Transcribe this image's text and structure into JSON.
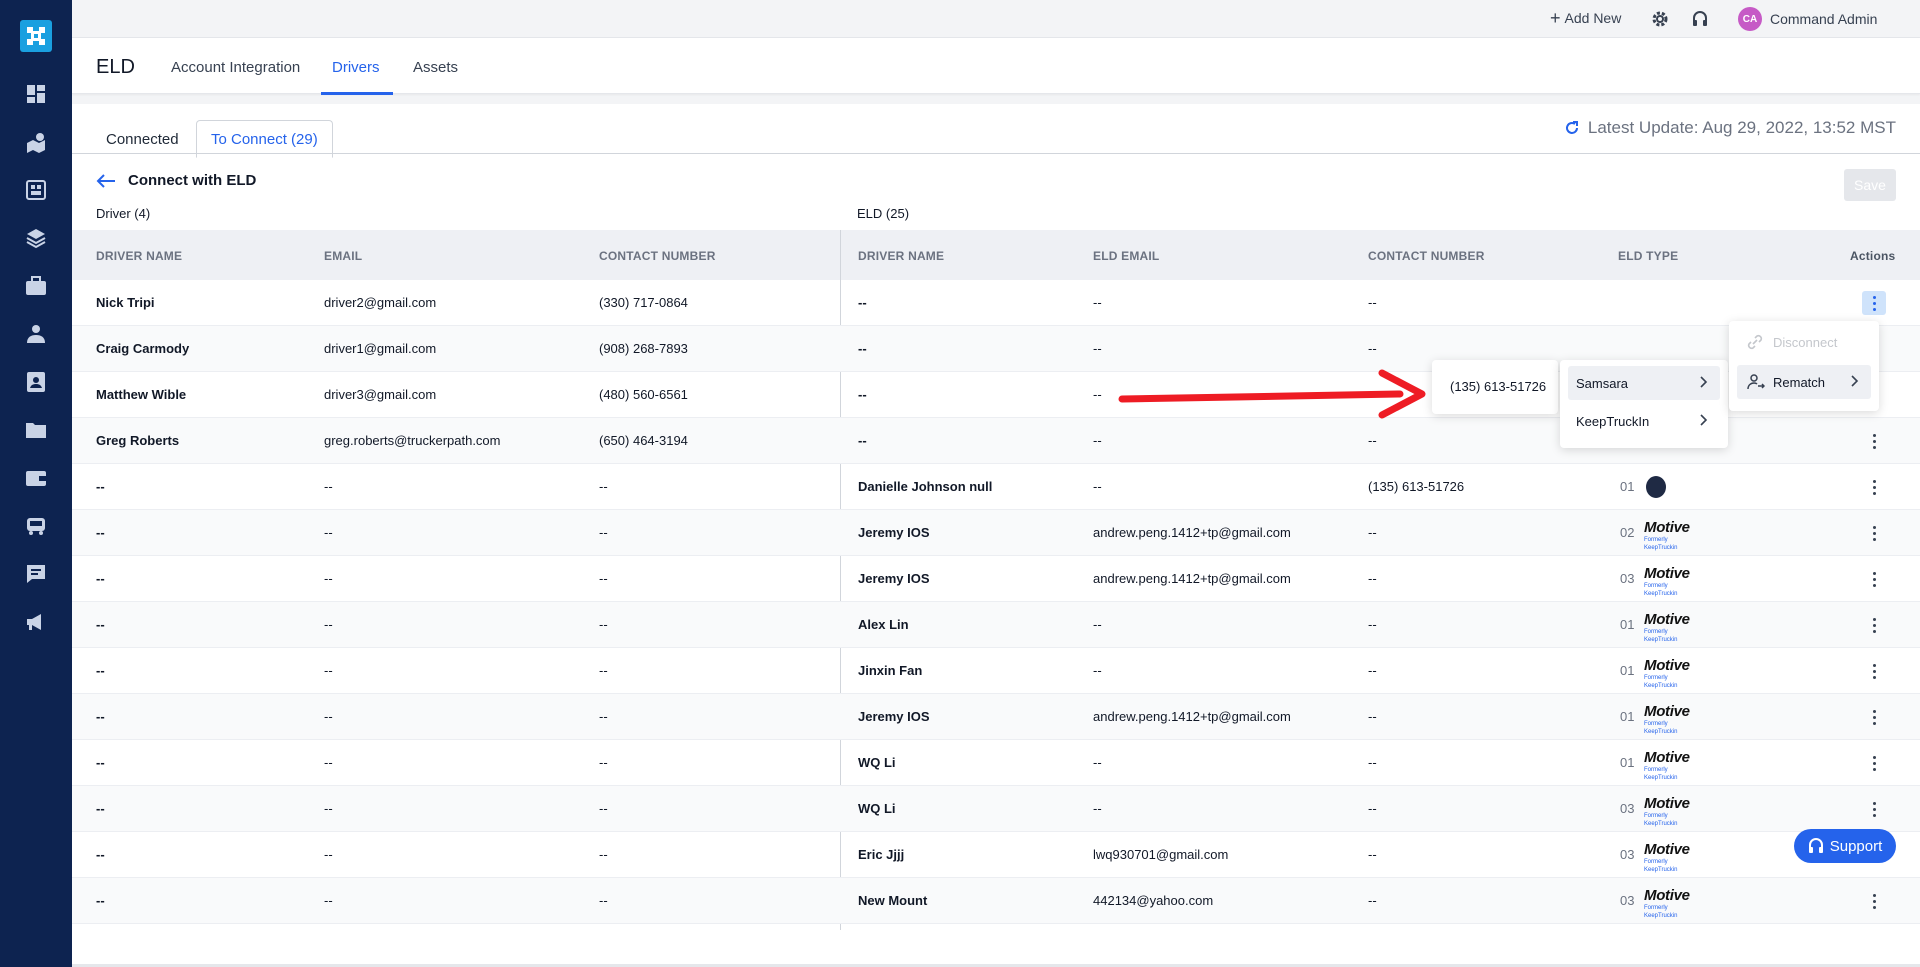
{
  "topbar": {
    "add_new": "Add New",
    "user_initials": "CA",
    "user_name": "Command Admin"
  },
  "header": {
    "app_title": "ELD",
    "tabs": [
      "Account Integration",
      "Drivers",
      "Assets"
    ]
  },
  "subtabs": {
    "connected": "Connected",
    "to_connect": "To Connect (29)"
  },
  "latest_update": "Latest Update: Aug 29, 2022, 13:52 MST",
  "connect_title": "Connect with ELD",
  "save_label": "Save",
  "driver_group_label": "Driver (4)",
  "eld_group_label": "ELD (25)",
  "columns": {
    "driver_name": "DRIVER NAME",
    "email": "EMAIL",
    "contact_number": "CONTACT NUMBER",
    "eld_driver_name": "DRIVER NAME",
    "eld_email": "ELD EMAIL",
    "eld_contact": "CONTACT NUMBER",
    "eld_type": "ELD TYPE",
    "actions": "Actions"
  },
  "motive_logo": {
    "name": "Motive",
    "sub": "Formerly KeepTruckin"
  },
  "rows": [
    {
      "name": "Nick Tripi",
      "email": "driver2@gmail.com",
      "contact": "(330) 717-0864",
      "eld_name": "--",
      "eld_email": "--",
      "eld_contact": "--",
      "eld_num": "",
      "eld_logo": ""
    },
    {
      "name": "Craig Carmody",
      "email": "driver1@gmail.com",
      "contact": "(908) 268-7893",
      "eld_name": "--",
      "eld_email": "--",
      "eld_contact": "--",
      "eld_num": "",
      "eld_logo": ""
    },
    {
      "name": "Matthew Wible",
      "email": "driver3@gmail.com",
      "contact": "(480) 560-6561",
      "eld_name": "--",
      "eld_email": "--",
      "eld_contact": "",
      "eld_num": "",
      "eld_logo": ""
    },
    {
      "name": "Greg Roberts",
      "email": "greg.roberts@truckerpath.com",
      "contact": "(650) 464-3194",
      "eld_name": "--",
      "eld_email": "--",
      "eld_contact": "--",
      "eld_num": "",
      "eld_logo": ""
    },
    {
      "name": "--",
      "email": "--",
      "contact": "--",
      "eld_name": "Danielle Johnson null",
      "eld_email": "--",
      "eld_contact": "(135) 613-51726",
      "eld_num": "01",
      "eld_logo": "samsara"
    },
    {
      "name": "--",
      "email": "--",
      "contact": "--",
      "eld_name": "Jeremy IOS",
      "eld_email": "andrew.peng.1412+tp@gmail.com",
      "eld_contact": "--",
      "eld_num": "02",
      "eld_logo": "motive"
    },
    {
      "name": "--",
      "email": "--",
      "contact": "--",
      "eld_name": "Jeremy IOS",
      "eld_email": "andrew.peng.1412+tp@gmail.com",
      "eld_contact": "--",
      "eld_num": "03",
      "eld_logo": "motive"
    },
    {
      "name": "--",
      "email": "--",
      "contact": "--",
      "eld_name": "Alex Lin",
      "eld_email": "--",
      "eld_contact": "--",
      "eld_num": "01",
      "eld_logo": "motive"
    },
    {
      "name": "--",
      "email": "--",
      "contact": "--",
      "eld_name": "Jinxin Fan",
      "eld_email": "--",
      "eld_contact": "--",
      "eld_num": "01",
      "eld_logo": "motive"
    },
    {
      "name": "--",
      "email": "--",
      "contact": "--",
      "eld_name": "Jeremy IOS",
      "eld_email": "andrew.peng.1412+tp@gmail.com",
      "eld_contact": "--",
      "eld_num": "01",
      "eld_logo": "motive"
    },
    {
      "name": "--",
      "email": "--",
      "contact": "--",
      "eld_name": "WQ Li",
      "eld_email": "--",
      "eld_contact": "--",
      "eld_num": "01",
      "eld_logo": "motive"
    },
    {
      "name": "--",
      "email": "--",
      "contact": "--",
      "eld_name": "WQ Li",
      "eld_email": "--",
      "eld_contact": "--",
      "eld_num": "03",
      "eld_logo": "motive"
    },
    {
      "name": "--",
      "email": "--",
      "contact": "--",
      "eld_name": "Eric Jjjj",
      "eld_email": "lwq930701@gmail.com",
      "eld_contact": "--",
      "eld_num": "03",
      "eld_logo": "motive"
    },
    {
      "name": "--",
      "email": "--",
      "contact": "--",
      "eld_name": "New Mount",
      "eld_email": "442134@yahoo.com",
      "eld_contact": "--",
      "eld_num": "03",
      "eld_logo": "motive"
    }
  ],
  "actions_menu": {
    "disconnect": "Disconnect",
    "rematch": "Rematch"
  },
  "eld_submenu": {
    "samsara": "Samsara",
    "keeptruckin": "KeepTruckIn"
  },
  "phone_popup": "(135) 613-51726",
  "support_label": "Support",
  "colors": {
    "sidebar": "#0d2350",
    "accent": "#2563eb",
    "logo_bg": "#1aa0e0",
    "annotation_arrow": "#ee1c24"
  }
}
